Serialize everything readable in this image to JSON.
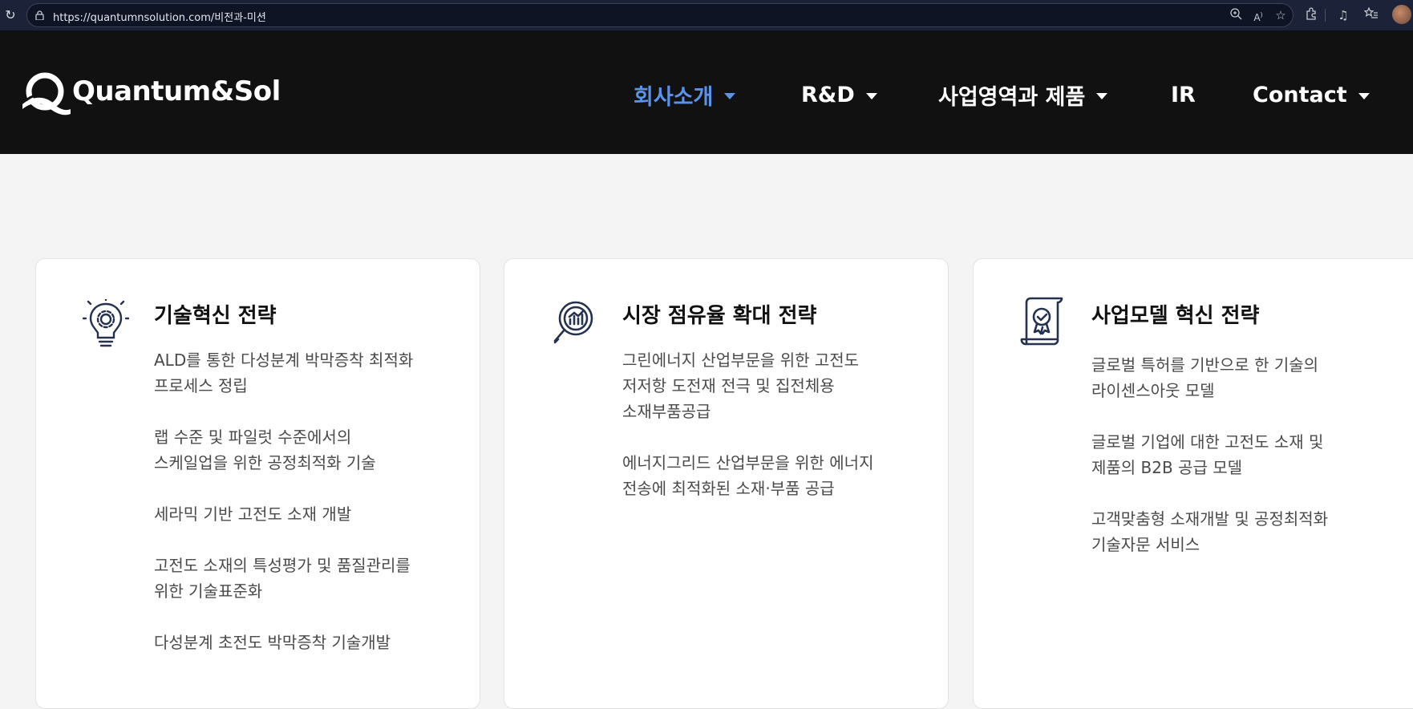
{
  "browser": {
    "url": "https://quantumnsolution.com/비전과-미션"
  },
  "site": {
    "logo_text": "Quantum&Sol",
    "nav": [
      {
        "label": "회사소개",
        "active": true
      },
      {
        "label": "R&D",
        "active": false
      },
      {
        "label": "사업영역과 제품",
        "active": false
      },
      {
        "label": "IR",
        "active": false
      },
      {
        "label": "Contact",
        "active": false
      }
    ]
  },
  "cards": [
    {
      "title": "기술혁신 전략",
      "icon": "lightbulb-gear-icon",
      "items": [
        "ALD를 통한 다성분계 박막증착 최적화 프로세스 정립",
        "랩 수준 및 파일럿 수준에서의 스케일업을 위한 공정최적화 기술",
        "세라믹 기반 고전도 소재 개발",
        "고전도 소재의 특성평가 및 품질관리를 위한 기술표준화",
        "다성분계 초전도 박막증착 기술개발"
      ]
    },
    {
      "title": "시장 점유율 확대 전략",
      "icon": "magnifier-chart-icon",
      "items": [
        "그린에너지 산업부문을 위한 고전도 저저항 도전재 전극 및 집전체용 소재부품공급",
        "에너지그리드 산업부문을 위한 에너지 전송에 최적화된 소재·부품 공급"
      ]
    },
    {
      "title": "사업모델 혁신 전략",
      "icon": "certificate-scroll-icon",
      "items": [
        "글로벌 특허를 기반으로 한 기술의 라이센스아웃 모델",
        "글로벌 기업에 대한 고전도 소재 및 제품의 B2B 공급 모델",
        "고객맞춤형 소재개발 및 공정최적화 기술자문 서비스"
      ]
    }
  ],
  "colors": {
    "header_bg": "#111111",
    "nav_active": "#5b93ea",
    "icon_navy": "#25324f"
  }
}
